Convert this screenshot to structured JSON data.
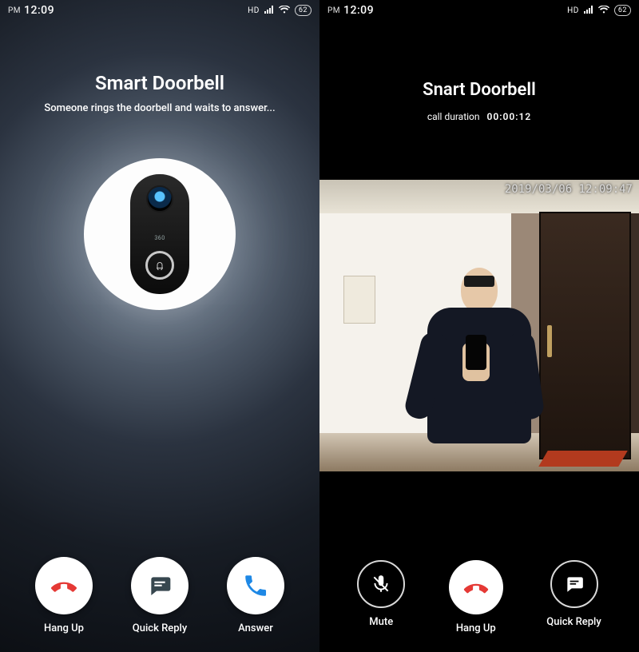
{
  "status": {
    "period": "PM",
    "time": "12:09",
    "net_label": "HD",
    "battery": "62"
  },
  "left": {
    "title": "Smart Doorbell",
    "subtitle": "Someone rings the doorbell and waits to answer...",
    "device_brand": "360",
    "buttons": {
      "hangup": "Hang Up",
      "quick_reply": "Quick  Reply",
      "answer": "Answer"
    }
  },
  "right": {
    "title": "Snart Doorbell",
    "duration_label": "call duration",
    "duration_value": "00:00:12",
    "video_timestamp": "2019/03/06 12:09:47",
    "buttons": {
      "mute": "Mute",
      "hangup": "Hang Up",
      "quick_reply": "Quick Reply"
    }
  }
}
